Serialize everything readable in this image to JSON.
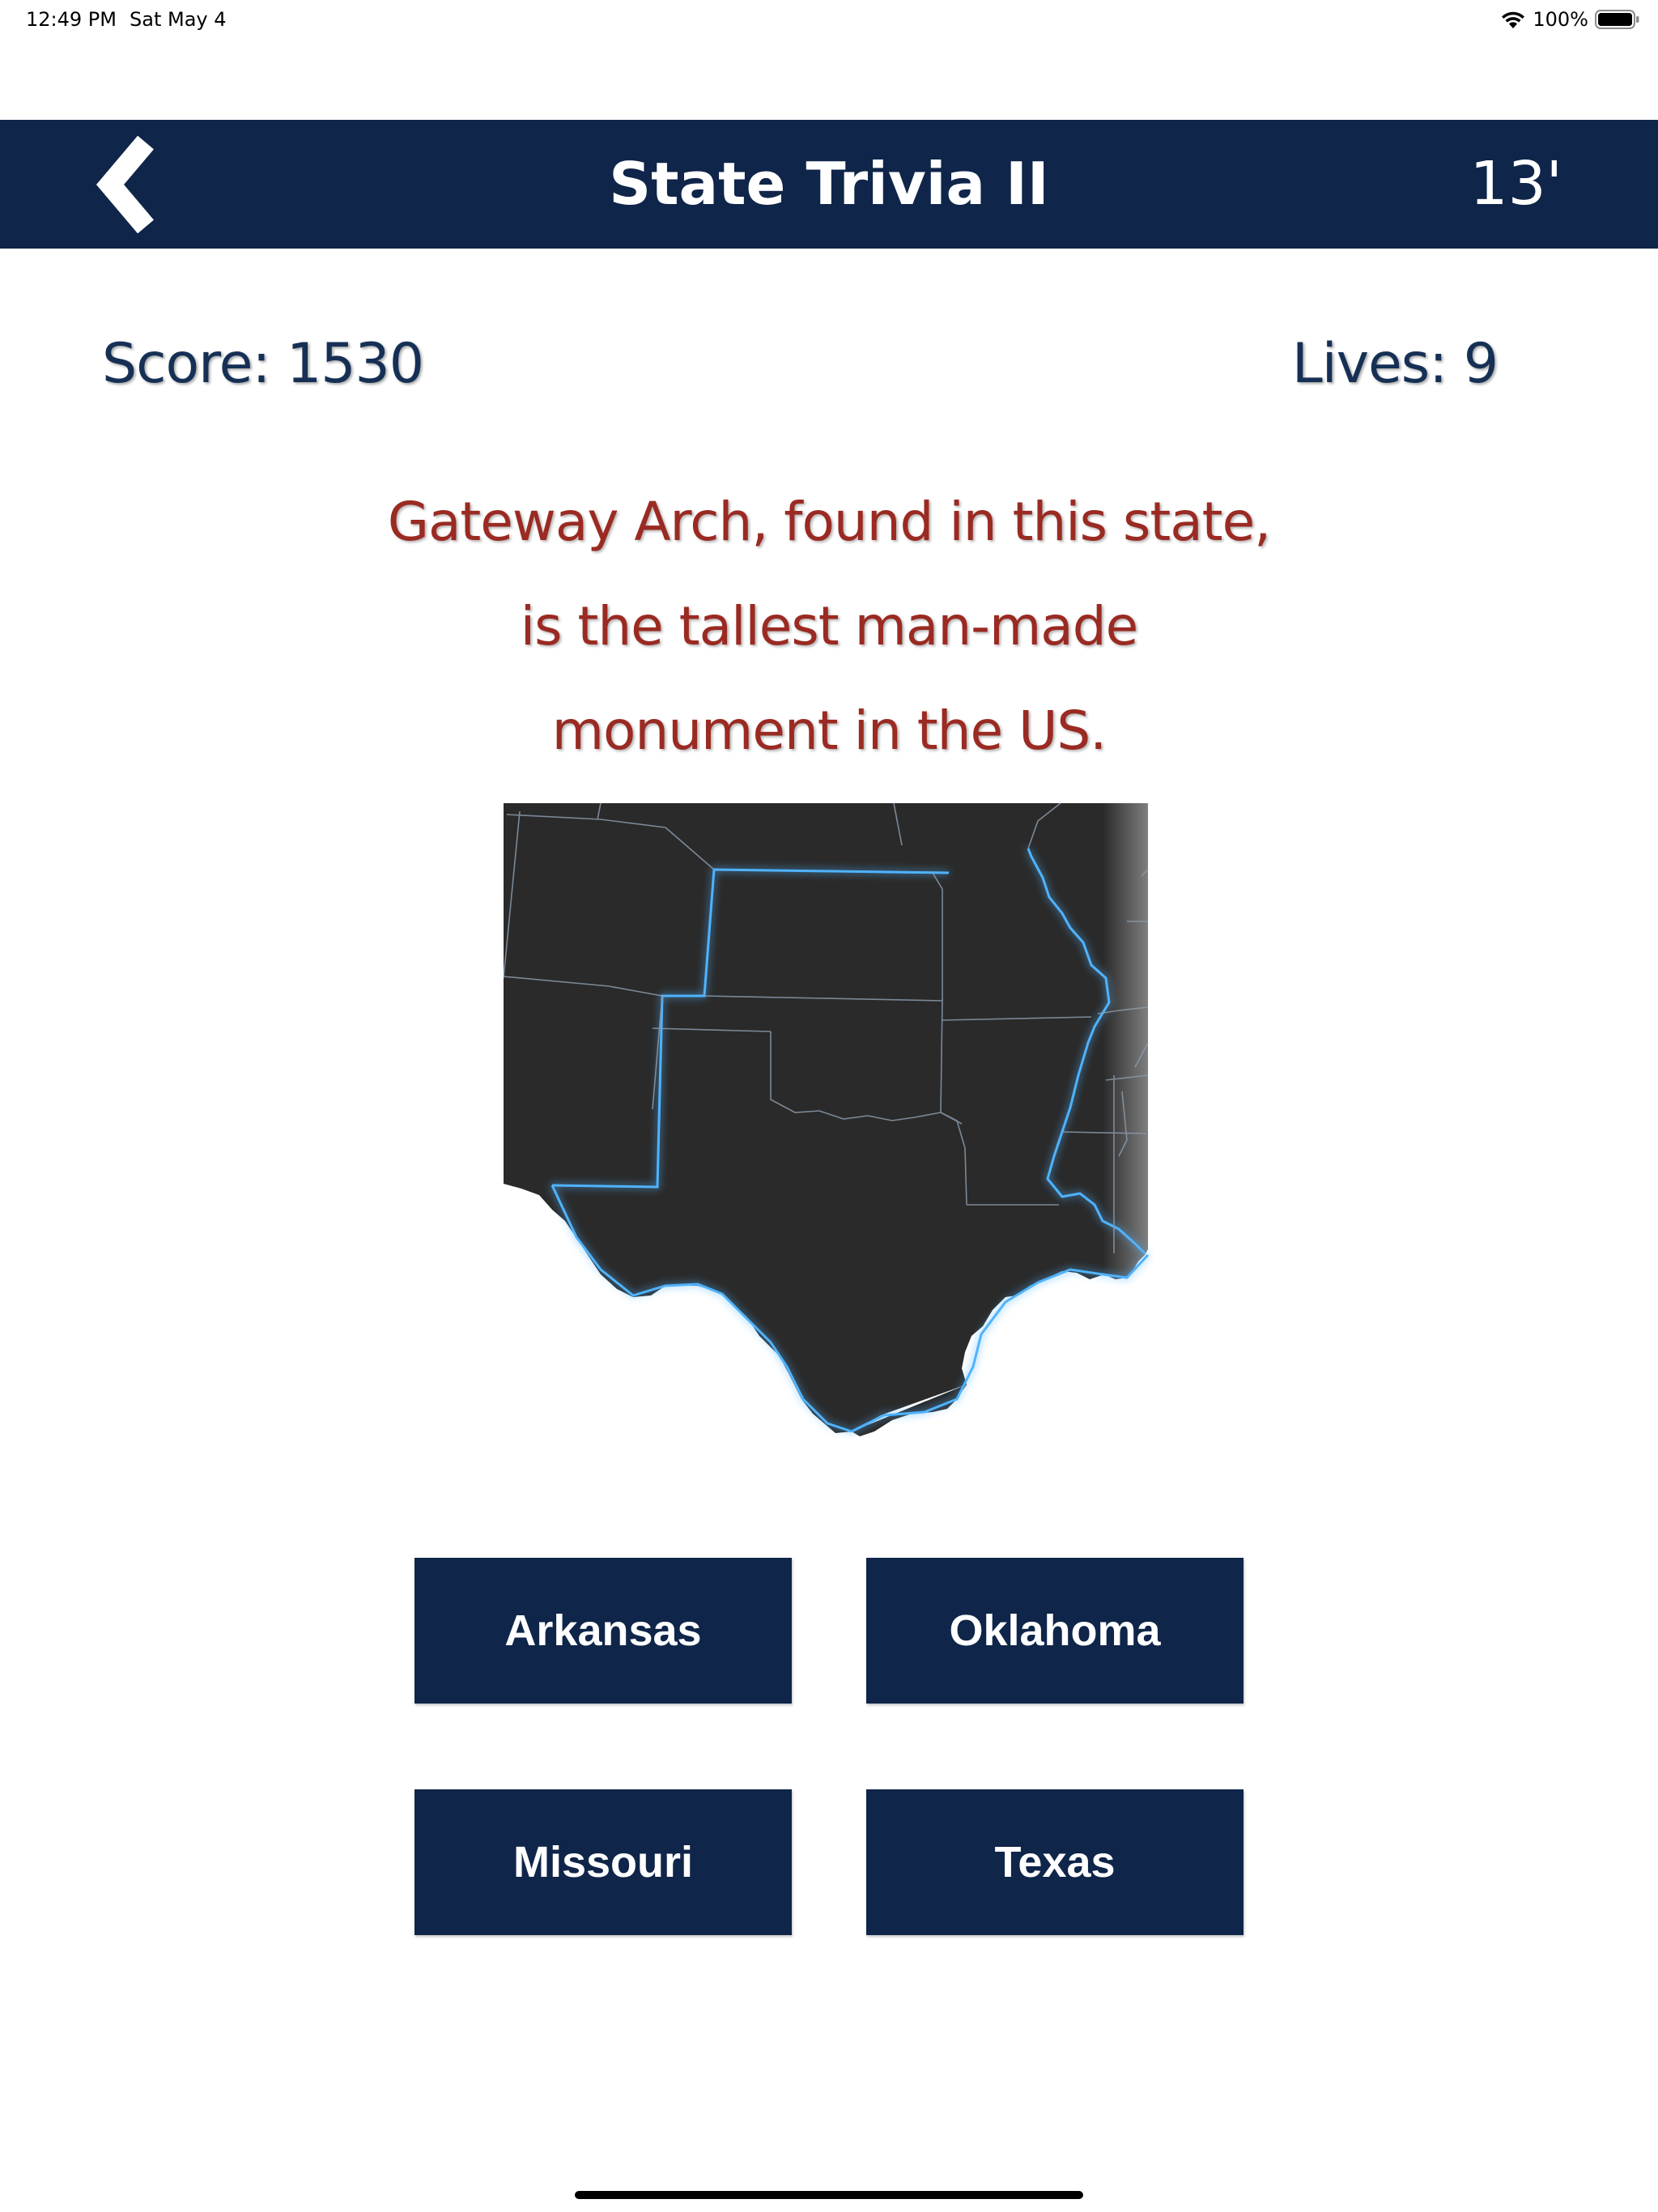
{
  "status_bar": {
    "time": "12:49 PM",
    "date": "Sat May 4",
    "battery": "100%",
    "wifi_icon": "wifi-icon",
    "battery_icon": "battery-icon"
  },
  "header": {
    "title": "State Trivia II",
    "timer": "13'",
    "back_icon": "chevron-left-icon",
    "background_color": "#0f2549"
  },
  "game": {
    "score_label": "Score: 1530",
    "lives_label": "Lives: 9"
  },
  "question": {
    "line1": "Gateway Arch, found in this state,",
    "line2": "is the tallest man-made",
    "line3": "monument in the US.",
    "color": "#9a2a22"
  },
  "answers": [
    {
      "label": "Arkansas"
    },
    {
      "label": "Oklahoma"
    },
    {
      "label": "Missouri"
    },
    {
      "label": "Texas"
    }
  ]
}
